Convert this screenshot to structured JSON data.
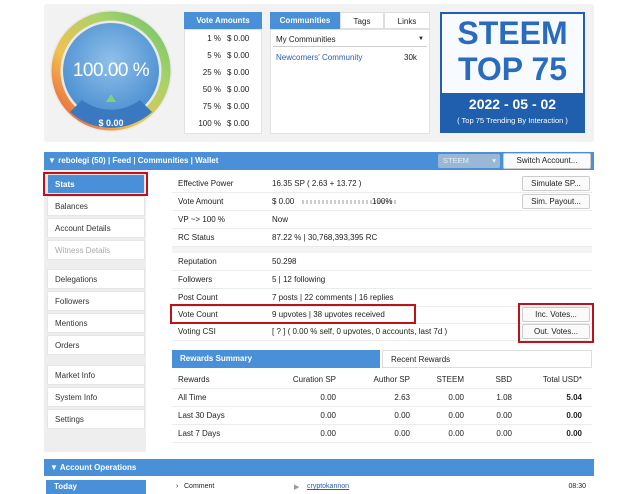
{
  "gauge": {
    "percent": "100.00 %",
    "usd": "$ 0.00",
    "level": 1.0
  },
  "vote_amounts": {
    "header": "Vote Amounts",
    "rows": [
      {
        "pct": "1 %",
        "val": "$ 0.00"
      },
      {
        "pct": "5 %",
        "val": "$ 0.00"
      },
      {
        "pct": "25 %",
        "val": "$ 0.00"
      },
      {
        "pct": "50 %",
        "val": "$ 0.00"
      },
      {
        "pct": "75 %",
        "val": "$ 0.00"
      },
      {
        "pct": "100 %",
        "val": "$ 0.00"
      }
    ]
  },
  "communities": {
    "tabs": [
      "Communities",
      "Tags",
      "Links"
    ],
    "select": "My Communities",
    "item": {
      "name": "Newcomers' Community",
      "count": "30k"
    }
  },
  "banner": {
    "title": "STEEM",
    "subtitle": "TOP 75",
    "date": "2022 - 05 - 02",
    "caption": "( Top 75 Trending By Interaction )"
  },
  "user_bar": {
    "user": "rebolegi (50)",
    "links": [
      "Feed",
      "Communities",
      "Wallet"
    ],
    "token": "STEEM",
    "switch": "Switch Account..."
  },
  "nav": {
    "group1": [
      "Stats",
      "Balances",
      "Account Details",
      "Witness Details"
    ],
    "group2": [
      "Delegations",
      "Followers",
      "Mentions",
      "Orders"
    ],
    "group3": [
      "Market Info",
      "System Info",
      "Settings"
    ]
  },
  "stats": {
    "effective_power": {
      "label": "Effective Power",
      "value": "16.35 SP ( 2.63 + 13.72 )",
      "button": "Simulate SP..."
    },
    "vote_amount": {
      "label": "Vote Amount",
      "value": "$ 0.00",
      "slider_pct": "100%",
      "button": "Sim. Payout..."
    },
    "vp": {
      "label": "VP ~> 100 %",
      "value": "Now"
    },
    "rc": {
      "label": "RC Status",
      "value": "87.22 %  |  30,768,393,395 RC"
    },
    "reputation": {
      "label": "Reputation",
      "value": "50.298"
    },
    "followers": {
      "label": "Followers",
      "value": "5  |  12 following"
    },
    "post_count": {
      "label": "Post Count",
      "value": "7 posts  |  22 comments  |  16 replies"
    },
    "vote_count": {
      "label": "Vote Count",
      "value": "9 upvotes  |  38 upvotes received",
      "button": "Inc. Votes..."
    },
    "voting_csi": {
      "label": "Voting CSI",
      "value": "[ ? ] ( 0.00 % self, 0 upvotes, 0 accounts, last 7d )",
      "button": "Out. Votes..."
    }
  },
  "rewards": {
    "tabs": [
      "Rewards Summary",
      "Recent Rewards"
    ],
    "headers": [
      "Rewards",
      "Curation SP",
      "Author SP",
      "STEEM",
      "SBD",
      "Total USD*"
    ],
    "rows": [
      [
        "All Time",
        "0.00",
        "2.63",
        "0.00",
        "1.08",
        "5.04"
      ],
      [
        "Last 30 Days",
        "0.00",
        "0.00",
        "0.00",
        "0.00",
        "0.00"
      ],
      [
        "Last 7 Days",
        "0.00",
        "0.00",
        "0.00",
        "0.00",
        "0.00"
      ]
    ]
  },
  "operations": {
    "header": "Account Operations",
    "today": "Today",
    "row": {
      "type": "Comment",
      "user": "cryptokannon",
      "time": "08:30"
    }
  }
}
